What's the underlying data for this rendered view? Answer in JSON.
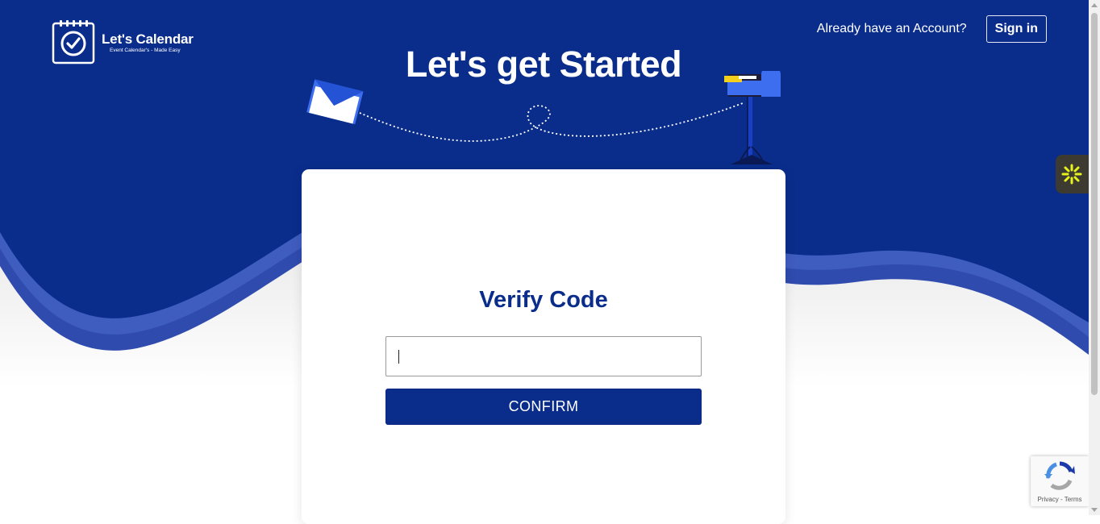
{
  "brand": {
    "name": "Let's Calendar",
    "tagline": "Event Calendar's - Made Easy"
  },
  "header": {
    "account_prompt": "Already have an Account?",
    "signin_label": "Sign in"
  },
  "hero": {
    "title": "Let's get Started"
  },
  "verify": {
    "title": "Verify Code",
    "code_value": "",
    "confirm_label": "CONFIRM"
  },
  "recaptcha": {
    "links": "Privacy - Terms"
  },
  "colors": {
    "brand_blue": "#0a2d8c",
    "wave_light": "#3a55b5",
    "accent_yellow": "#f5cf1d",
    "widget_bg": "#3d3a32"
  },
  "icons": {
    "logo": "calendar-check-icon",
    "envelope": "envelope-icon",
    "mailbox": "mailbox-icon",
    "widget": "asterisk-icon",
    "recaptcha": "recaptcha-icon"
  }
}
